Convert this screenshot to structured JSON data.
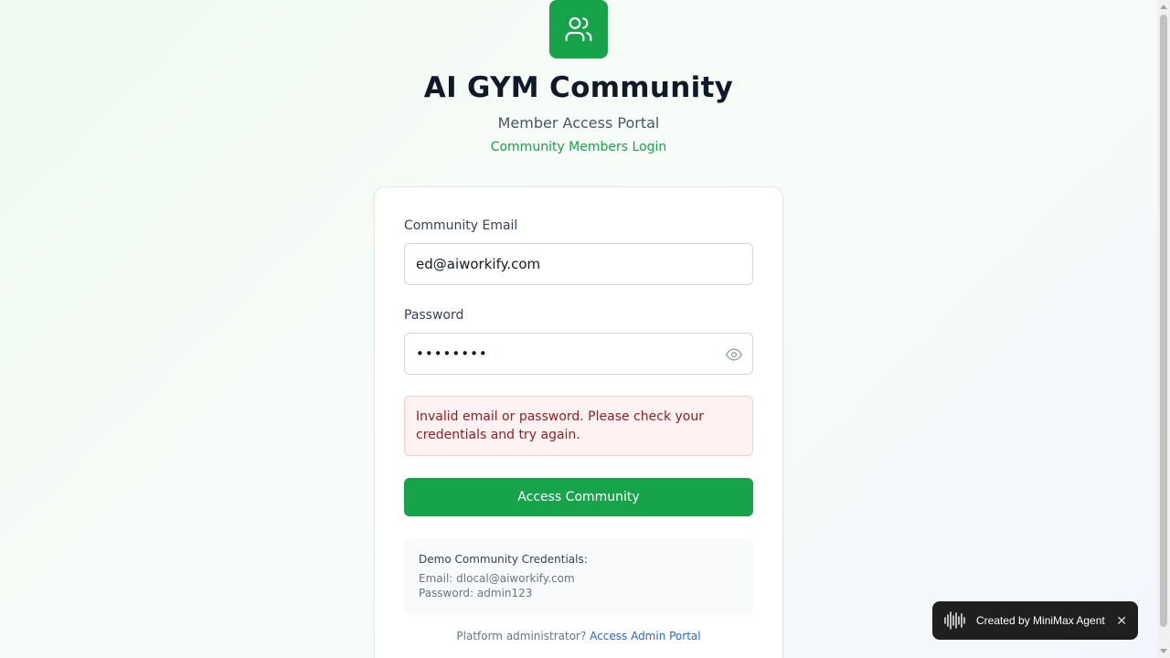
{
  "header": {
    "title": "AI GYM Community",
    "subtitle": "Member Access Portal",
    "tagline": "Community Members Login",
    "logo_icon": "users-icon"
  },
  "form": {
    "email_label": "Community Email",
    "email_value": "ed@aiworkify.com",
    "password_label": "Password",
    "password_value": "••••••••",
    "error_message": "Invalid email or password. Please check your credentials and try again.",
    "submit_label": "Access Community"
  },
  "demo": {
    "heading": "Demo Community Credentials:",
    "email_line": "Email: dlocal@aiworkify.com",
    "password_line": "Password: admin123"
  },
  "footer": {
    "admin_prompt": "Platform administrator?",
    "admin_link": "Access Admin Portal"
  },
  "badge": {
    "text": "Created by MiniMax Agent",
    "close": "✕"
  },
  "colors": {
    "accent": "#16a34a",
    "error_bg": "#fef2f2",
    "error_text": "#991b1b",
    "link": "#2563eb"
  }
}
